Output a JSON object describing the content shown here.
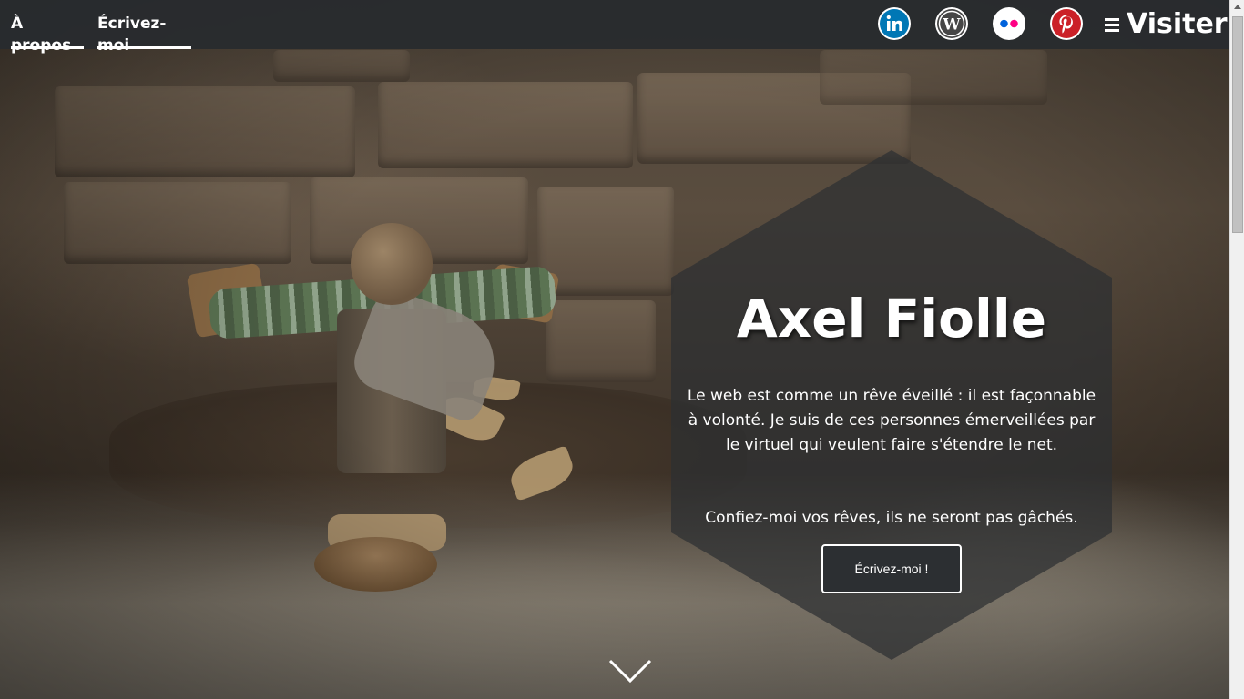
{
  "nav": {
    "links": [
      {
        "label": "À propos"
      },
      {
        "label": "Écrivez-moi"
      }
    ],
    "social": [
      {
        "icon": "linkedin-icon",
        "color": "#0077b5"
      },
      {
        "icon": "wordpress-icon",
        "color": "#464646"
      },
      {
        "icon": "flickr-icon",
        "color": "#ff0084"
      },
      {
        "icon": "pinterest-icon",
        "color": "#cb2027"
      }
    ],
    "visit_label": "Visiter"
  },
  "hero": {
    "title": "Axel Fiolle",
    "paragraph1": "Le web est comme un rêve éveillé : il est façonnable à volonté. Je suis de ces personnes émerveillées par le virtuel qui veulent faire s'étendre le net.",
    "paragraph2": "Confiez-moi vos rêves, ils ne seront pas gâchés.",
    "cta_label": "Écrivez-moi !",
    "scroll_icon": "chevron-down-icon"
  }
}
